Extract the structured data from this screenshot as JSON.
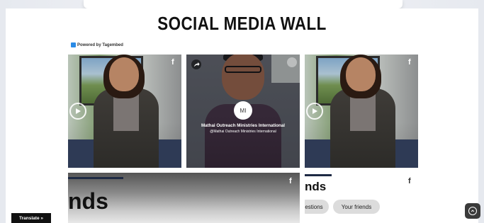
{
  "page": {
    "title": "SOCIAL MEDIA WALL",
    "powered_by": "Powered by Tagembed"
  },
  "posts": [
    {
      "network_icon": "facebook-icon",
      "network_label": "f",
      "media": "video"
    },
    {
      "author": "Mathai Outreach Ministries International",
      "handle": "@Mathai Outreach Ministries International",
      "avatar_initials": "MI",
      "media": "image"
    },
    {
      "network_icon": "facebook-icon",
      "network_label": "f",
      "media": "video"
    },
    {
      "network_icon": "facebook-icon",
      "network_label": "f",
      "text": "nds"
    },
    {
      "network_icon": "facebook-icon",
      "network_label": "f",
      "text": "nds",
      "pills": [
        "estions",
        "Your friends"
      ]
    }
  ],
  "widgets": {
    "translate_label": "Translate »",
    "scroll_top_icon": "chevron-up-icon"
  },
  "colors": {
    "accent_dark": "#1e2a44",
    "facebook_icon": "#ffffff"
  }
}
